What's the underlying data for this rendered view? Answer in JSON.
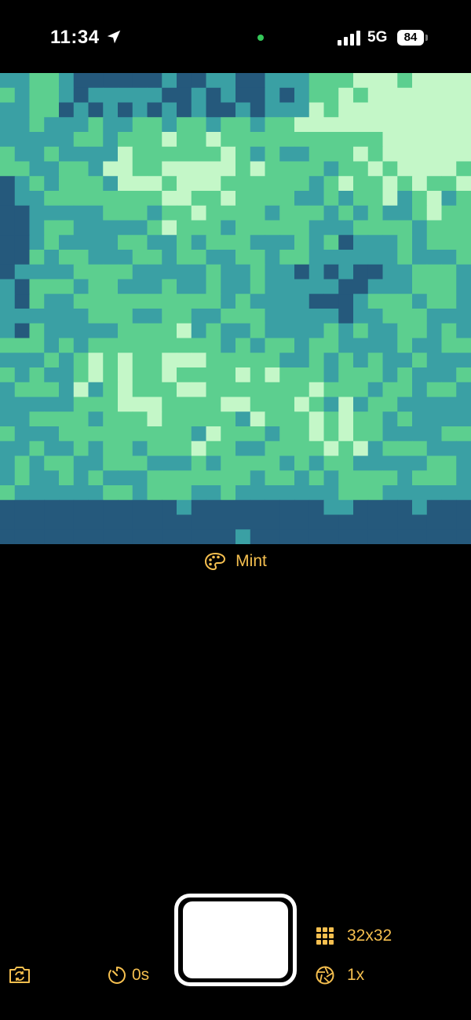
{
  "status_bar": {
    "time": "11:34",
    "network": "5G",
    "battery": "84"
  },
  "preview": {
    "grid_size": 32,
    "palette_colors": [
      "#25597c",
      "#3aa0a4",
      "#5ccf8f",
      "#c4f7c8"
    ]
  },
  "palette": {
    "name": "Mint"
  },
  "controls": {
    "timer_label": "0s",
    "resolution_label": "32x32",
    "zoom_label": "1x"
  },
  "colors": {
    "accent": "#f5bf4f",
    "background": "#000000"
  },
  "icons": {
    "location": "location-arrow-icon",
    "palette": "palette-icon",
    "camera_flip": "camera-flip-icon",
    "timer": "timer-icon",
    "grid": "grid-icon",
    "aperture": "aperture-icon"
  }
}
